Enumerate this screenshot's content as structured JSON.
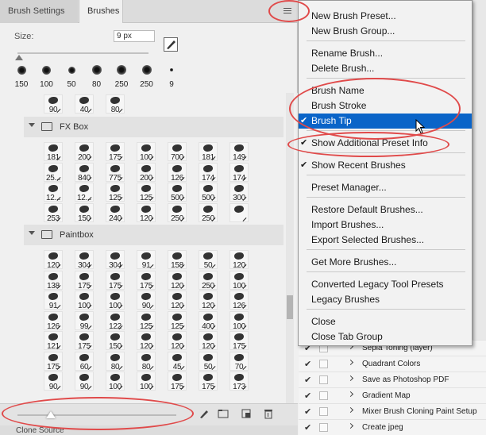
{
  "panel": {
    "tabs": [
      "Brush Settings",
      "Brushes"
    ],
    "size_label": "Size:",
    "size_value": "9 px",
    "presets": [
      {
        "value": "150",
        "dot": 11
      },
      {
        "value": "100",
        "dot": 11
      },
      {
        "value": "50",
        "dot": 9
      },
      {
        "value": "80",
        "dot": 12
      },
      {
        "value": "250",
        "dot": 12
      },
      {
        "value": "250",
        "dot": 12
      },
      {
        "value": "9",
        "dot": 4
      }
    ],
    "top_partial_row": [
      "90",
      "40",
      "80"
    ],
    "groups": [
      {
        "name": "FX Box",
        "rows": [
          [
            "181",
            "200",
            "175",
            "100",
            "700",
            "181",
            "149"
          ],
          [
            "25...",
            "840",
            "775",
            "200",
            "126",
            "174",
            "174"
          ],
          [
            "12...",
            "12...",
            "125",
            "125",
            "500",
            "500",
            "300"
          ],
          [
            "253",
            "150",
            "240",
            "120",
            "250",
            "250",
            ""
          ]
        ]
      },
      {
        "name": "Paintbox",
        "rows": [
          [
            "120",
            "304",
            "304",
            "91",
            "158",
            "50",
            "120"
          ],
          [
            "138",
            "175",
            "175",
            "175",
            "120",
            "250",
            "100"
          ],
          [
            "91",
            "100",
            "100",
            "90",
            "120",
            "120",
            "126"
          ],
          [
            "126",
            "99",
            "122",
            "125",
            "125",
            "400",
            "100"
          ],
          [
            "121",
            "175",
            "150",
            "120",
            "120",
            "120",
            "175"
          ],
          [
            "175",
            "60",
            "80",
            "80",
            "45",
            "50",
            "70"
          ],
          [
            "90",
            "90",
            "100",
            "100",
            "175",
            "175",
            "173"
          ]
        ]
      }
    ],
    "footer_icons": [
      "brush-settings-icon",
      "folder-icon",
      "new-brush-icon",
      "trash-icon"
    ],
    "clone_source_label": "Clone Source"
  },
  "menu": {
    "items": [
      {
        "label": "New Brush Preset...",
        "checked": false,
        "selected": false
      },
      {
        "label": "New Brush Group...",
        "checked": false,
        "selected": false
      },
      {
        "sep": true
      },
      {
        "label": "Rename Brush...",
        "checked": false,
        "selected": false
      },
      {
        "label": "Delete Brush...",
        "checked": false,
        "selected": false
      },
      {
        "sep": true
      },
      {
        "label": "Brush Name",
        "checked": false,
        "selected": false
      },
      {
        "label": "Brush Stroke",
        "checked": false,
        "selected": false
      },
      {
        "label": "Brush Tip",
        "checked": true,
        "selected": true
      },
      {
        "sep": true
      },
      {
        "label": "Show Additional Preset Info",
        "checked": true,
        "selected": false
      },
      {
        "sep": true
      },
      {
        "label": "Show Recent Brushes",
        "checked": true,
        "selected": false
      },
      {
        "sep": true
      },
      {
        "label": "Preset Manager...",
        "checked": false,
        "selected": false
      },
      {
        "sep": true
      },
      {
        "label": "Restore Default Brushes...",
        "checked": false,
        "selected": false
      },
      {
        "label": "Import Brushes...",
        "checked": false,
        "selected": false
      },
      {
        "label": "Export Selected Brushes...",
        "checked": false,
        "selected": false
      },
      {
        "sep": true
      },
      {
        "label": "Get More Brushes...",
        "checked": false,
        "selected": false
      },
      {
        "sep": true
      },
      {
        "label": "Converted Legacy Tool Presets",
        "checked": false,
        "selected": false
      },
      {
        "label": "Legacy Brushes",
        "checked": false,
        "selected": false
      },
      {
        "sep": true
      },
      {
        "label": "Close",
        "checked": false,
        "selected": false
      },
      {
        "label": "Close Tab Group",
        "checked": false,
        "selected": false
      }
    ]
  },
  "actions": [
    {
      "label": "Sepia Toning (layer)",
      "checked": true
    },
    {
      "label": "Quadrant Colors",
      "checked": true
    },
    {
      "label": "Save as Photoshop PDF",
      "checked": true
    },
    {
      "label": "Gradient Map",
      "checked": true
    },
    {
      "label": "Mixer Brush Cloning Paint Setup",
      "checked": true
    },
    {
      "label": "Create jpeg",
      "checked": true
    }
  ],
  "annotation_color": "#e04a4a",
  "selection_color": "#0a64c8"
}
